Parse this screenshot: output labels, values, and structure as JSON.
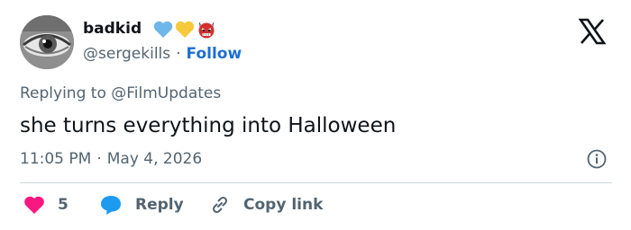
{
  "author": {
    "name": "badkid",
    "handle": "@sergekills",
    "separator": "·",
    "follow_label": "Follow",
    "badges": [
      "blue-heart-icon",
      "yellow-heart-icon",
      "ogre-mask-icon"
    ]
  },
  "tweet": {
    "replying_to": "Replying to @FilmUpdates",
    "text": "she turns everything into Halloween",
    "time": "11:05 PM",
    "date_separator": "·",
    "date": "May 4, 2026"
  },
  "actions": {
    "likes": "5",
    "reply_label": "Reply",
    "copy_label": "Copy link"
  },
  "colors": {
    "link": "#1d6fd1",
    "muted": "#536471",
    "like": "#f91880",
    "reply": "#1d9bf0"
  }
}
